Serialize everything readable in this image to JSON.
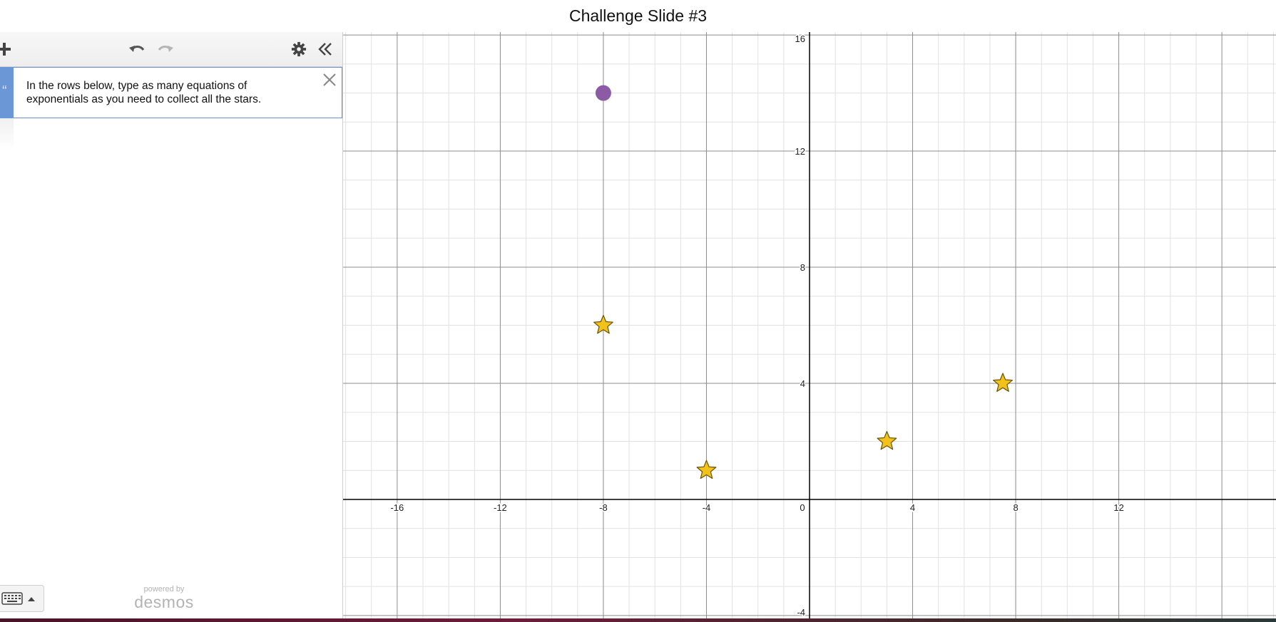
{
  "header": {
    "title": "Challenge Slide #3"
  },
  "toolbar": {
    "add_icon": "plus-icon",
    "undo_icon": "undo-icon",
    "redo_icon": "redo-icon",
    "settings_icon": "gear-icon",
    "collapse_icon": "double-chevron-left-icon"
  },
  "expression_list": {
    "note_text": "In the rows below, type as many equations of exponentials as you need to collect all the stars.",
    "close_icon": "close-icon"
  },
  "keypad": {
    "keyboard_icon": "keyboard-icon",
    "toggle_icon": "caret-up-icon"
  },
  "branding": {
    "powered_by": "powered by",
    "name": "desmos"
  },
  "colors": {
    "note_tab": "#6b97d6",
    "point": "#8d5ba6",
    "star_fill": "#f2c21b",
    "star_stroke": "#6b5200",
    "major_grid": "#8c8c8c",
    "minor_grid": "#e2e2e2",
    "axis": "#000000"
  },
  "chart_data": {
    "type": "scatter",
    "xlim": [
      -18.1,
      18.1
    ],
    "ylim": [
      -4.1,
      16.1
    ],
    "grid": true,
    "major_step": 4,
    "minor_step": 1,
    "x_ticks": [
      "-16",
      "-12",
      "-8",
      "-4",
      "0",
      "4",
      "8",
      "12"
    ],
    "x_tick_values": [
      -16,
      -12,
      -8,
      -4,
      0,
      4,
      8,
      12
    ],
    "y_ticks": [
      "16",
      "12",
      "8",
      "4",
      "-4"
    ],
    "y_tick_values": [
      16,
      12,
      8,
      4,
      -4
    ],
    "points": [
      {
        "x": -8,
        "y": 14,
        "marker": "circle"
      }
    ],
    "stars": [
      {
        "x": -8,
        "y": 6
      },
      {
        "x": -4,
        "y": 1
      },
      {
        "x": 3,
        "y": 2
      },
      {
        "x": 7.5,
        "y": 4
      }
    ]
  }
}
